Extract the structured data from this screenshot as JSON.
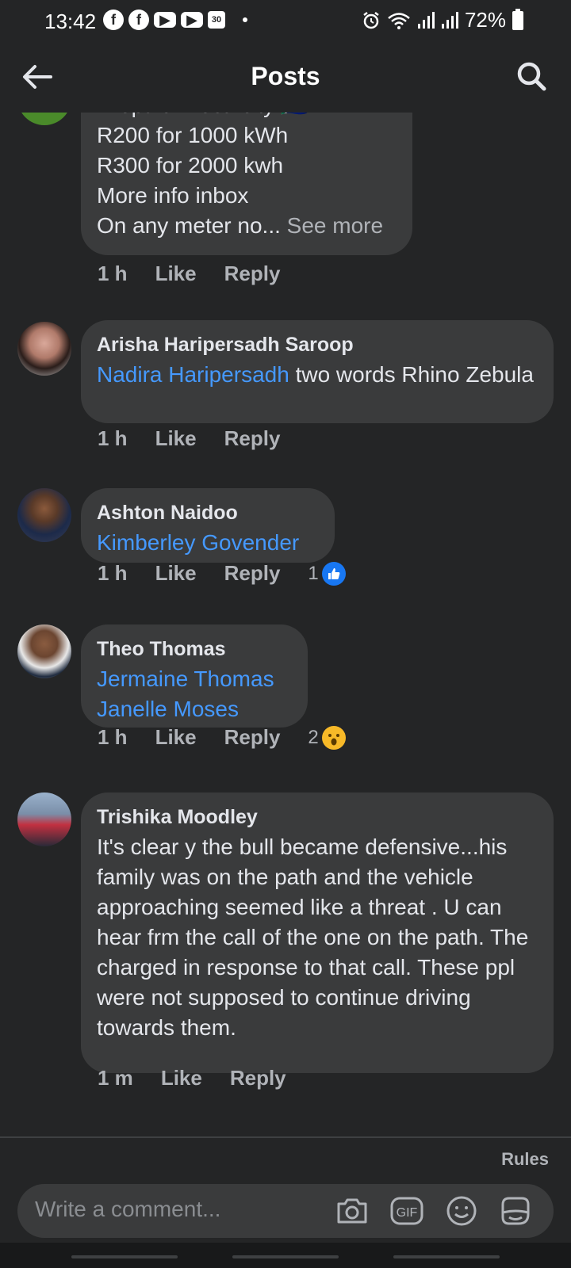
{
  "status_bar": {
    "time": "13:42",
    "notif_icons": [
      "facebook-icon",
      "facebook-icon",
      "youtube-icon",
      "youtube-icon",
      "calendar-icon"
    ],
    "calendar_day": "30",
    "battery": "72%"
  },
  "header": {
    "title": "Posts"
  },
  "comments": [
    {
      "partial": true,
      "lines": [
        "Prepaid Electricity 🇿🇦",
        "R200 for 1000 kWh",
        "R300 for 2000 kwh",
        "More info inbox",
        "On any meter no..."
      ],
      "see_more": "See more",
      "time": "1 h",
      "like": "Like",
      "reply": "Reply"
    },
    {
      "name": "Arisha Haripersadh Saroop",
      "tag": "Nadira Haripersadh",
      "text": " two words Rhino Zebula",
      "time": "1 h",
      "like": "Like",
      "reply": "Reply"
    },
    {
      "name": "Ashton Naidoo",
      "tag": "Kimberley Govender",
      "time": "1 h",
      "like": "Like",
      "reply": "Reply",
      "reaction_count": "1",
      "reaction": "like"
    },
    {
      "name": "Theo Thomas",
      "tags": [
        "Jermaine Thomas",
        "Janelle Moses"
      ],
      "time": "1 h",
      "like": "Like",
      "reply": "Reply",
      "reaction_count": "2",
      "reaction": "wow"
    },
    {
      "name": "Trishika Moodley",
      "text": "It's clear y the bull became defensive...his family was on the path and the vehicle approaching seemed like a threat . U can hear frm the call of the one on the path. The charged in response to that call. These ppl were not supposed to continue driving towards them.",
      "time": "1 m",
      "like": "Like",
      "reply": "Reply"
    }
  ],
  "composer": {
    "rules": "Rules",
    "placeholder": "Write a comment...",
    "gif_label": "GIF"
  },
  "colors": {
    "background": "#242526",
    "bubble": "#3a3b3c",
    "tag": "#4599ff",
    "muted": "#b0b3b8",
    "like_blue": "#1877f2",
    "wow_yellow": "#f7b928"
  }
}
